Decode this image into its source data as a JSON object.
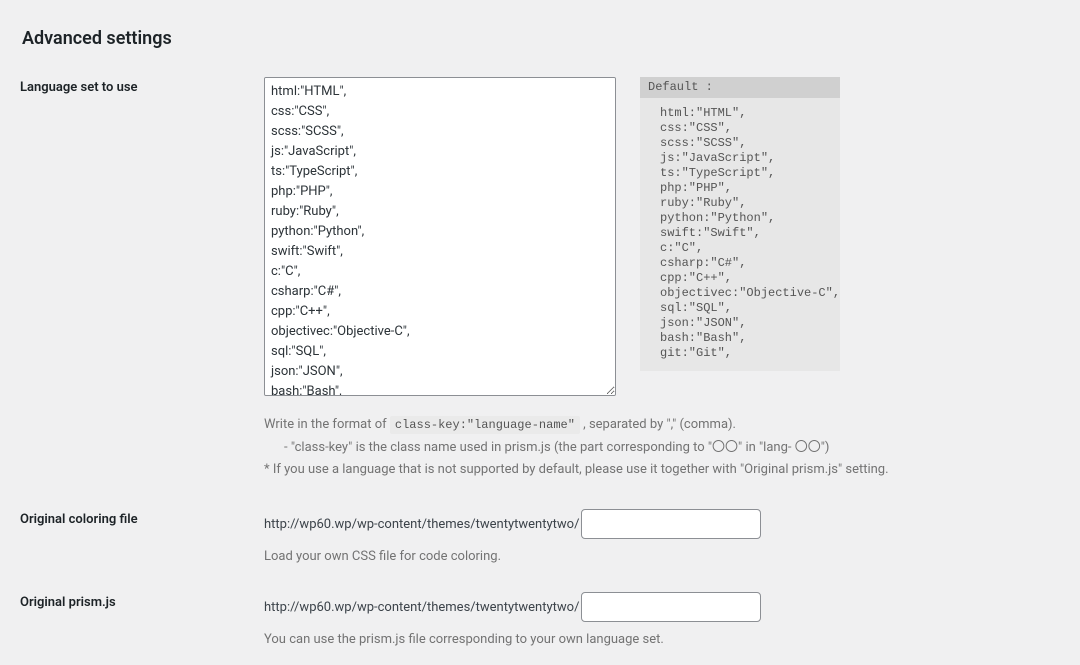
{
  "section_title": "Advanced settings",
  "labels": {
    "language_set": "Language set to use",
    "original_color": "Original coloring file",
    "original_prism": "Original prism.js"
  },
  "languageset_value": "html:\"HTML\",\ncss:\"CSS\",\nscss:\"SCSS\",\njs:\"JavaScript\",\nts:\"TypeScript\",\nphp:\"PHP\",\nruby:\"Ruby\",\npython:\"Python\",\nswift:\"Swift\",\nc:\"C\",\ncsharp:\"C#\",\ncpp:\"C++\",\nobjectivec:\"Objective-C\",\nsql:\"SQL\",\njson:\"JSON\",\nbash:\"Bash\",",
  "default_panel": {
    "header": "Default :",
    "body": "html:\"HTML\",\ncss:\"CSS\",\nscss:\"SCSS\",\njs:\"JavaScript\",\nts:\"TypeScript\",\nphp:\"PHP\",\nruby:\"Ruby\",\npython:\"Python\",\nswift:\"Swift\",\nc:\"C\",\ncsharp:\"C#\",\ncpp:\"C++\",\nobjectivec:\"Objective-C\",\nsql:\"SQL\",\njson:\"JSON\",\nbash:\"Bash\",\ngit:\"Git\","
  },
  "help": {
    "line1_a": "Write in the format of ",
    "line1_code": "class-key:\"language-name\"",
    "line1_b": " , separated by \",\" (comma).",
    "line2": "- \"class-key\" is the class name used in prism.js (the part corresponding to \"〇〇\" in \"lang- 〇〇\")",
    "line3": "* If you use a language that is not supported by default, please use it together with \"Original prism.js\" setting."
  },
  "path_prefix": "http://wp60.wp/wp-content/themes/twentytwentytwo/",
  "original_color_value": "",
  "original_color_help": "Load your own CSS file for code coloring.",
  "original_prism_value": "",
  "original_prism_help": "You can use the prism.js file corresponding to your own language set."
}
